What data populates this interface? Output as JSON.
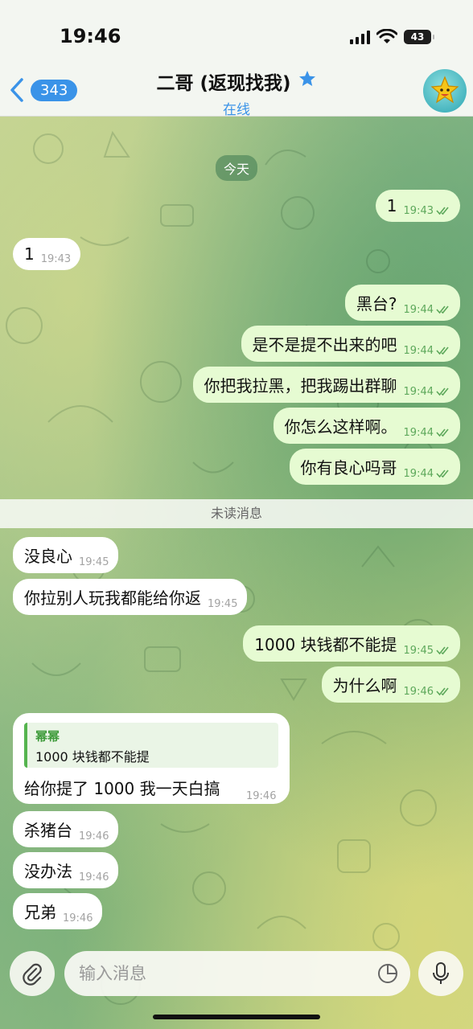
{
  "status": {
    "time": "19:46",
    "battery": "43"
  },
  "header": {
    "back_badge": "343",
    "title": "二哥 (返现找我)",
    "subtitle": "在线",
    "icons": [
      "chevron-left-icon",
      "star-icon",
      "avatar-star-icon"
    ]
  },
  "chat": {
    "date_label": "今天",
    "unread_label": "未读消息",
    "messages": [
      {
        "dir": "out",
        "text": "1",
        "time": "19:43"
      },
      {
        "dir": "in",
        "text": "1",
        "time": "19:43"
      },
      {
        "dir": "out",
        "text": "黑台?",
        "time": "19:44"
      },
      {
        "dir": "out",
        "text": "是不是提不出来的吧",
        "time": "19:44"
      },
      {
        "dir": "out",
        "text": "你把我拉黑，把我踢出群聊",
        "time": "19:44"
      },
      {
        "dir": "out",
        "text": "你怎么这样啊。",
        "time": "19:44"
      },
      {
        "dir": "out",
        "text": "你有良心吗哥",
        "time": "19:44"
      },
      {
        "dir": "in",
        "text": "没良心",
        "time": "19:45"
      },
      {
        "dir": "in",
        "text": "你拉别人玩我都能给你返",
        "time": "19:45"
      },
      {
        "dir": "out",
        "text": "1000 块钱都不能提",
        "time": "19:45"
      },
      {
        "dir": "out",
        "text": "为什么啊",
        "time": "19:46"
      },
      {
        "dir": "in",
        "text": "杀猪台",
        "time": "19:46"
      },
      {
        "dir": "in",
        "text": "没办法",
        "time": "19:46"
      },
      {
        "dir": "in",
        "text": "兄弟",
        "time": "19:46"
      }
    ],
    "reply_message": {
      "quote_name": "幂幂",
      "quote_text": "1000 块钱都不能提",
      "text": "给你提了 1000 我一天白搞",
      "time": "19:46"
    }
  },
  "input": {
    "placeholder": "输入消息",
    "icons": [
      "paperclip-icon",
      "sticker-icon",
      "microphone-icon"
    ]
  },
  "colors": {
    "accent": "#3a93e8",
    "outgoing_bubble": "#e6fbd2",
    "check": "#5da85b"
  }
}
